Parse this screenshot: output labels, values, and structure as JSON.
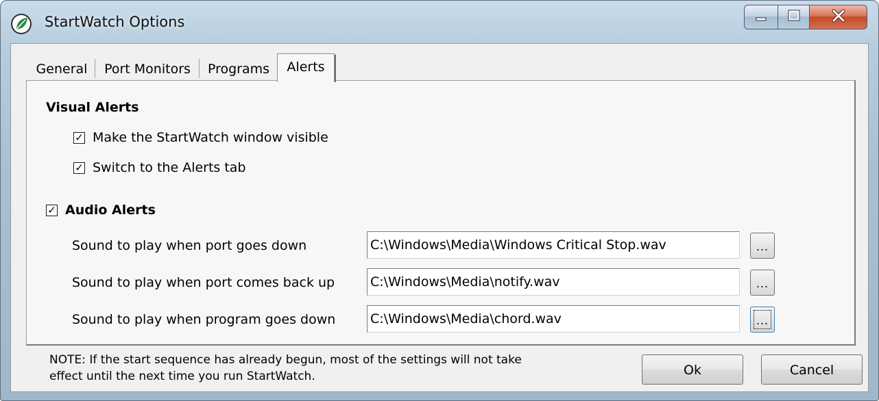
{
  "window": {
    "title": "StartWatch Options",
    "app_icon": "startwatch-leaf-icon",
    "caption_buttons": {
      "minimize": "minimize-icon",
      "maximize": "maximize-icon",
      "close": "close-icon"
    }
  },
  "tabs": [
    {
      "label": "General",
      "active": false
    },
    {
      "label": "Port Monitors",
      "active": false
    },
    {
      "label": "Programs",
      "active": false
    },
    {
      "label": "Alerts",
      "active": true
    }
  ],
  "visual_alerts": {
    "heading": "Visual Alerts",
    "options": [
      {
        "label": "Make the StartWatch window visible",
        "checked": true
      },
      {
        "label": "Switch to the Alerts tab",
        "checked": true
      }
    ]
  },
  "audio_alerts": {
    "label": "Audio Alerts",
    "checked": true,
    "rows": [
      {
        "label": "Sound to play when port goes down",
        "value": "C:\\Windows\\Media\\Windows Critical Stop.wav",
        "browse": "..."
      },
      {
        "label": "Sound to play when port comes back up",
        "value": "C:\\Windows\\Media\\notify.wav",
        "browse": "..."
      },
      {
        "label": "Sound to play when program goes down",
        "value": "C:\\Windows\\Media\\chord.wav",
        "browse": "..."
      }
    ]
  },
  "note": {
    "line1": "NOTE: If the start sequence has already begun, most of the settings will not take",
    "line2": "effect until the next time you run StartWatch."
  },
  "buttons": {
    "ok": "Ok",
    "cancel": "Cancel"
  },
  "check_glyph": "✓",
  "colors": {
    "title_bar": "#b5cddd",
    "close_button": "#c44b2a",
    "dialog_bg": "#f0f0f0"
  }
}
